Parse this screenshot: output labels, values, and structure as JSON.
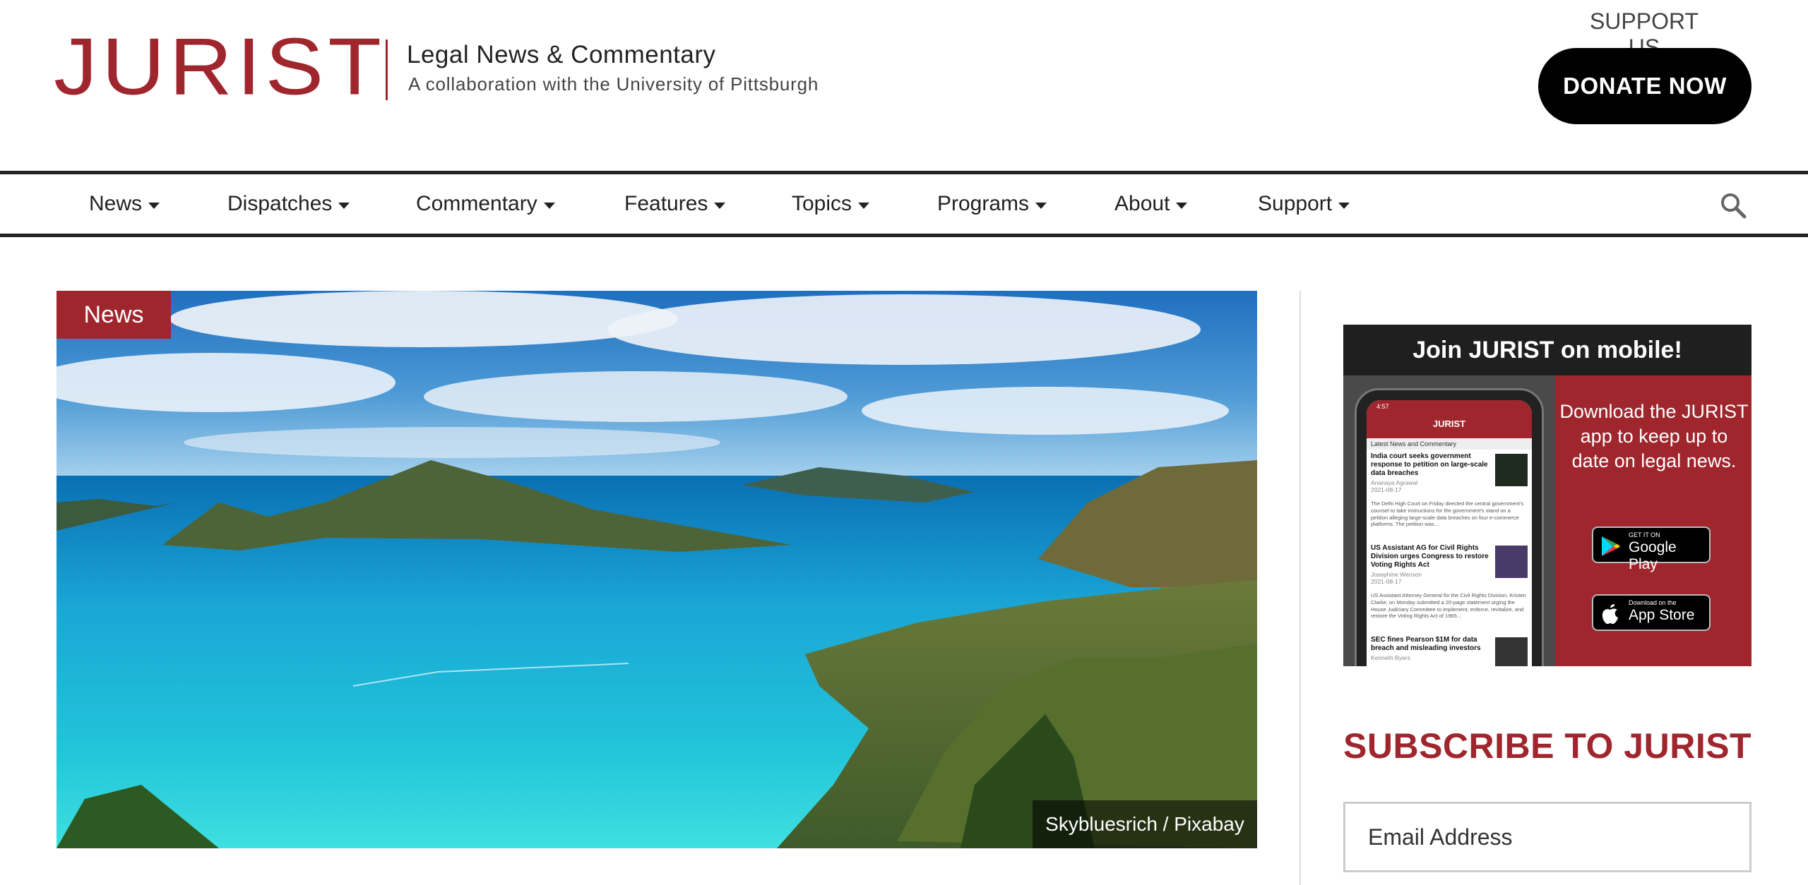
{
  "brand": {
    "logo": "JURIST",
    "tagline": "Legal News & Commentary",
    "subtagline": "A collaboration with  the University of Pittsburgh",
    "color": "#a0262e"
  },
  "support": {
    "label": "SUPPORT US",
    "donate": "DONATE NOW"
  },
  "nav": {
    "items": [
      {
        "label": "News"
      },
      {
        "label": "Dispatches"
      },
      {
        "label": "Commentary"
      },
      {
        "label": "Features"
      },
      {
        "label": "Topics"
      },
      {
        "label": "Programs"
      },
      {
        "label": "About"
      },
      {
        "label": "Support"
      }
    ],
    "search_icon": "search-icon"
  },
  "hero": {
    "category": "News",
    "credit": "Skybluesrich / Pixabay"
  },
  "app_promo": {
    "title": "Join JURIST on mobile!",
    "text": "Download the JURIST app to keep up to date on legal news.",
    "google_small": "GET IT ON",
    "google_big": "Google Play",
    "apple_small": "Download on the",
    "apple_big": "App Store",
    "phone": {
      "time": "4:57",
      "title": "JURIST",
      "subtitle": "Latest News and Commentary",
      "items": [
        {
          "title": "India court seeks government response to petition on large-scale data breaches",
          "author": "Ananaya Agrawal",
          "date": "2021-08-17",
          "body": "The Delhi High Court on Friday directed the central government's counsel to take instructions for the government's stand on a petition alleging large-scale data breaches on four e-commerce platforms. The petition was..."
        },
        {
          "title": "US Assistant AG for Civil Rights Division urges Congress to restore Voting Rights Act",
          "author": "Josephine Wenson",
          "date": "2021-08-17",
          "body": "US Assistant Attorney General for the Civil Rights Division, Kristen Clarke, on Monday submitted a 20-page statement urging the House Judiciary Committee to implement, enforce, revitalize, and restore the Voting Rights Act of 1965..."
        },
        {
          "title": "SEC fines Pearson $1M for data breach and misleading investors",
          "author": "Kenneth Byers",
          "date": "",
          "body": ""
        }
      ]
    }
  },
  "subscribe": {
    "title": "SUBSCRIBE TO JURIST",
    "email_placeholder": "Email Address"
  }
}
